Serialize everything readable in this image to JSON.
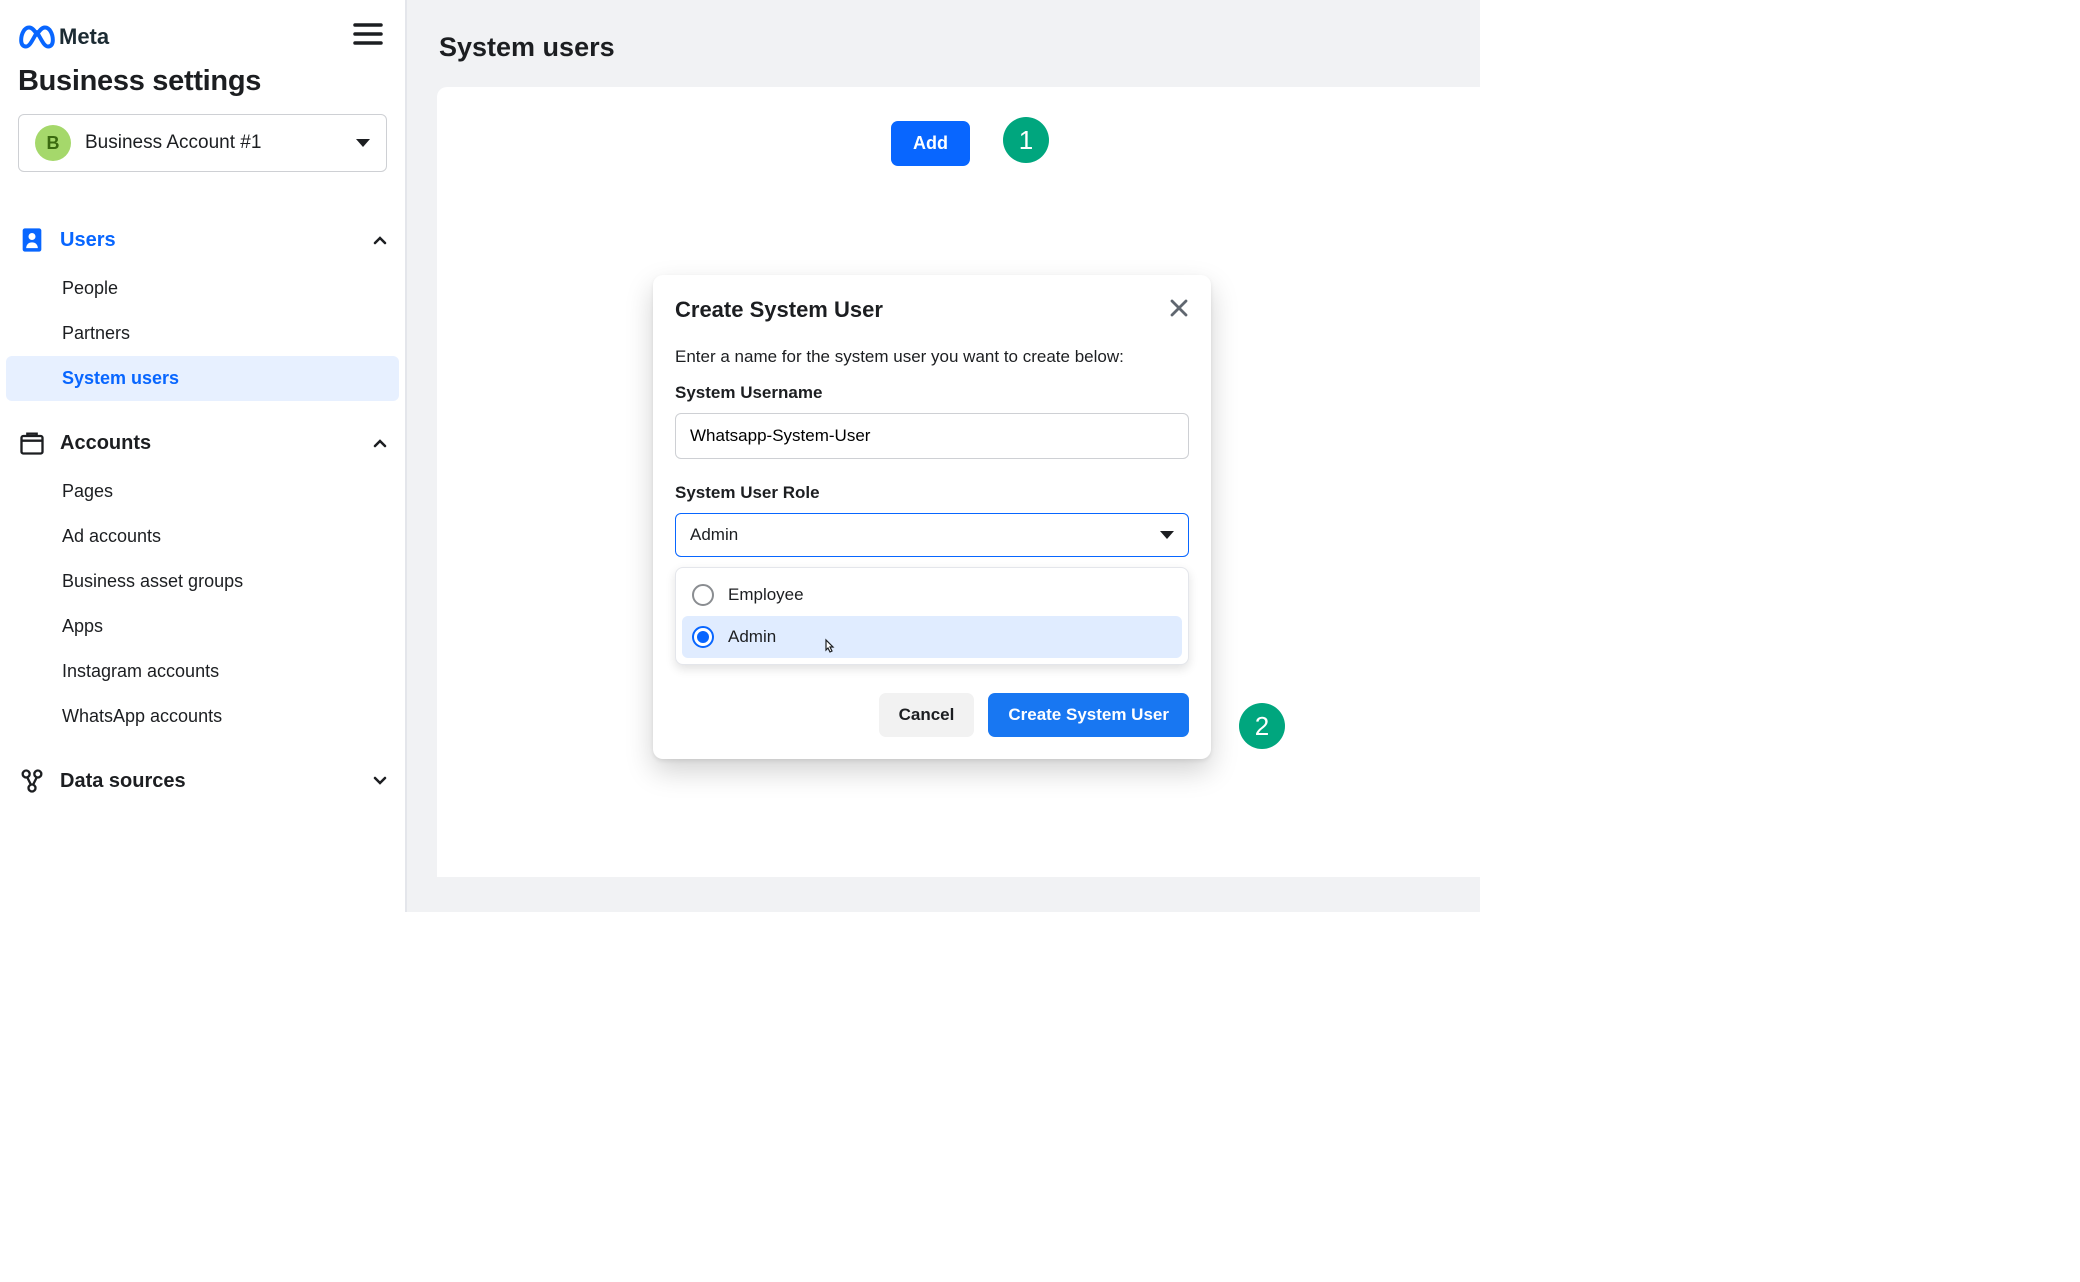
{
  "brand": {
    "name": "Meta"
  },
  "sidebar": {
    "title": "Business settings",
    "account": {
      "initial": "B",
      "label": "Business Account #1"
    },
    "groups": [
      {
        "label": "Users",
        "active": true,
        "expanded": true,
        "items": [
          {
            "label": "People"
          },
          {
            "label": "Partners"
          },
          {
            "label": "System users",
            "selected": true
          }
        ]
      },
      {
        "label": "Accounts",
        "active": false,
        "expanded": true,
        "items": [
          {
            "label": "Pages"
          },
          {
            "label": "Ad accounts"
          },
          {
            "label": "Business asset groups"
          },
          {
            "label": "Apps"
          },
          {
            "label": "Instagram accounts"
          },
          {
            "label": "WhatsApp accounts"
          }
        ]
      },
      {
        "label": "Data sources",
        "active": false,
        "expanded": false,
        "items": []
      }
    ]
  },
  "main": {
    "title": "System users",
    "add_label": "Add"
  },
  "callouts": {
    "one": "1",
    "two": "2"
  },
  "dialog": {
    "title": "Create System User",
    "instruction": "Enter a name for the system user you want to create below:",
    "username_label": "System Username",
    "username_value": "Whatsapp-System-User",
    "role_label": "System User Role",
    "role_value": "Admin",
    "options": [
      {
        "label": "Employee",
        "selected": false
      },
      {
        "label": "Admin",
        "selected": true
      }
    ],
    "cancel_label": "Cancel",
    "submit_label": "Create System User"
  }
}
